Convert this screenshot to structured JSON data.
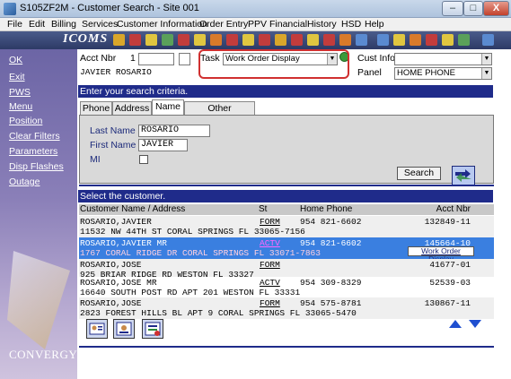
{
  "window": {
    "title": "S105ZF2M - Customer Search - Site 001",
    "min": "–",
    "max": "□",
    "close": "X"
  },
  "menu": [
    "File",
    "Edit",
    "Billing",
    "Services",
    "Customer Information",
    "Order Entry",
    "PPV",
    "Financial",
    "History",
    "HSD",
    "Help"
  ],
  "toolbar": {
    "logo": "ICOMS"
  },
  "sidebar": {
    "items": [
      "OK",
      "Exit",
      "PWS",
      "Menu",
      "Position",
      "Clear Filters",
      "Parameters",
      "Disp Flashes",
      "Outage"
    ],
    "brand": "CONVERGYS"
  },
  "form": {
    "acct_label": "Acct Nbr",
    "acct_value": "1",
    "task_label": "Task",
    "task_value": "Work Order Display",
    "cust_info_label": "Cust Info",
    "cust_info_value": "",
    "panel_label": "Panel",
    "panel_value": "HOME PHONE",
    "customer_name": "JAVIER ROSARIO"
  },
  "criteria_bar": "Enter your search criteria.",
  "tabs": [
    "Phone",
    "Address",
    "Name",
    "Other Searches..."
  ],
  "search": {
    "last_name_label": "Last Name",
    "last_name_value": "ROSARIO",
    "first_name_label": "First Name",
    "first_name_value": "JAVIER",
    "mi_label": "MI",
    "search_button": "Search"
  },
  "select_bar": "Select the customer.",
  "table": {
    "headers": {
      "name": "Customer Name / Address",
      "st": "St",
      "phone": "Home Phone",
      "acct": "Acct Nbr"
    },
    "rows": [
      {
        "name": "ROSARIO,JAVIER",
        "address": "11532 NW 44TH ST CORAL SPRINGS  FL 33065-7156",
        "st": "FORM",
        "phone": "954 821-6602",
        "acct": "132849-11"
      },
      {
        "name": "ROSARIO,JAVIER MR",
        "address": "1767 CORAL RIDGE DR CORAL SPRINGS  FL 33071-7863",
        "st": "ACTV",
        "phone": "954 821-6602",
        "acct": "145664-10"
      },
      {
        "name": "ROSARIO,JOSE",
        "address": "925 BRIAR RIDGE RD WESTON  FL 33327",
        "st": "FORM",
        "phone": "",
        "acct": "41677-01"
      },
      {
        "name": "ROSARIO,JOSE MR",
        "address": "16640 SOUTH POST RD APT 201 WESTON  FL 33331",
        "st": "ACTV",
        "phone": "954 309-8329",
        "acct": "52539-03"
      },
      {
        "name": "ROSARIO,JOSE",
        "address": "2823 FOREST HILLS BL APT  9 CORAL SPRINGS  FL 33065-5470",
        "st": "FORM",
        "phone": "954 575-8781",
        "acct": "130867-11"
      }
    ],
    "tooltip": "Work Order Display"
  }
}
